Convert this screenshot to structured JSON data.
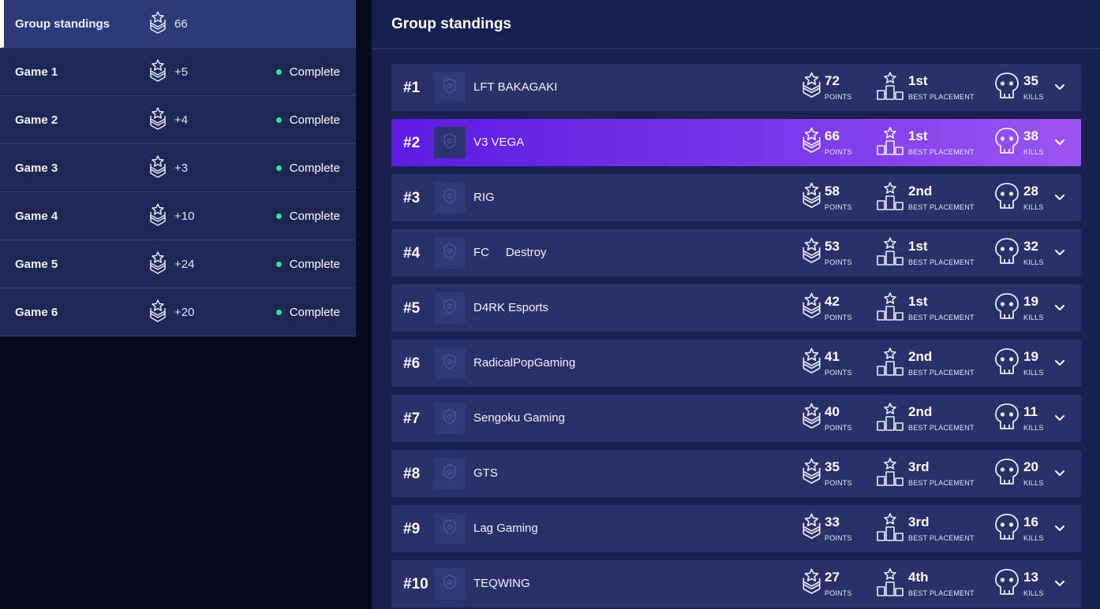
{
  "sidebar": {
    "items": [
      {
        "label": "Group standings",
        "points": "66",
        "status": "",
        "active": true
      },
      {
        "label": "Game 1",
        "points": "+5",
        "status": "Complete",
        "active": false
      },
      {
        "label": "Game 2",
        "points": "+4",
        "status": "Complete",
        "active": false
      },
      {
        "label": "Game 3",
        "points": "+3",
        "status": "Complete",
        "active": false
      },
      {
        "label": "Game 4",
        "points": "+10",
        "status": "Complete",
        "active": false
      },
      {
        "label": "Game 5",
        "points": "+24",
        "status": "Complete",
        "active": false
      },
      {
        "label": "Game 6",
        "points": "+20",
        "status": "Complete",
        "active": false
      }
    ]
  },
  "main": {
    "title": "Group standings",
    "labels": {
      "points": "POINTS",
      "best_placement": "BEST PLACEMENT",
      "kills": "KILLS"
    },
    "standings": [
      {
        "rank": "#1",
        "team": "LFT BAKAGAKI",
        "points": "72",
        "best_placement": "1st",
        "kills": "35",
        "highlight": false
      },
      {
        "rank": "#2",
        "team": "V3 VEGA",
        "points": "66",
        "best_placement": "1st",
        "kills": "38",
        "highlight": true
      },
      {
        "rank": "#3",
        "team": "RIG",
        "points": "58",
        "best_placement": "2nd",
        "kills": "28",
        "highlight": false
      },
      {
        "rank": "#4",
        "team": "FC     Destroy",
        "points": "53",
        "best_placement": "1st",
        "kills": "32",
        "highlight": false
      },
      {
        "rank": "#5",
        "team": "D4RK Esports",
        "points": "42",
        "best_placement": "1st",
        "kills": "19",
        "highlight": false
      },
      {
        "rank": "#6",
        "team": "RadicalPopGaming",
        "points": "41",
        "best_placement": "2nd",
        "kills": "19",
        "highlight": false
      },
      {
        "rank": "#7",
        "team": "Sengoku Gaming",
        "points": "40",
        "best_placement": "2nd",
        "kills": "11",
        "highlight": false
      },
      {
        "rank": "#8",
        "team": "GTS",
        "points": "35",
        "best_placement": "3rd",
        "kills": "20",
        "highlight": false
      },
      {
        "rank": "#9",
        "team": "Lag Gaming",
        "points": "33",
        "best_placement": "3rd",
        "kills": "16",
        "highlight": false
      },
      {
        "rank": "#10",
        "team": "TEQWING",
        "points": "27",
        "best_placement": "4th",
        "kills": "13",
        "highlight": false
      }
    ]
  },
  "icons": {
    "points": "rank-chevron-star-icon",
    "placement": "podium-icon",
    "kills": "skull-icon",
    "expand": "chevron-down-icon",
    "team_logo": "shield-icon"
  },
  "colors": {
    "status_complete": "#2ee59d",
    "highlight_start": "#5a1de0",
    "highlight_end": "#9b55f2"
  }
}
